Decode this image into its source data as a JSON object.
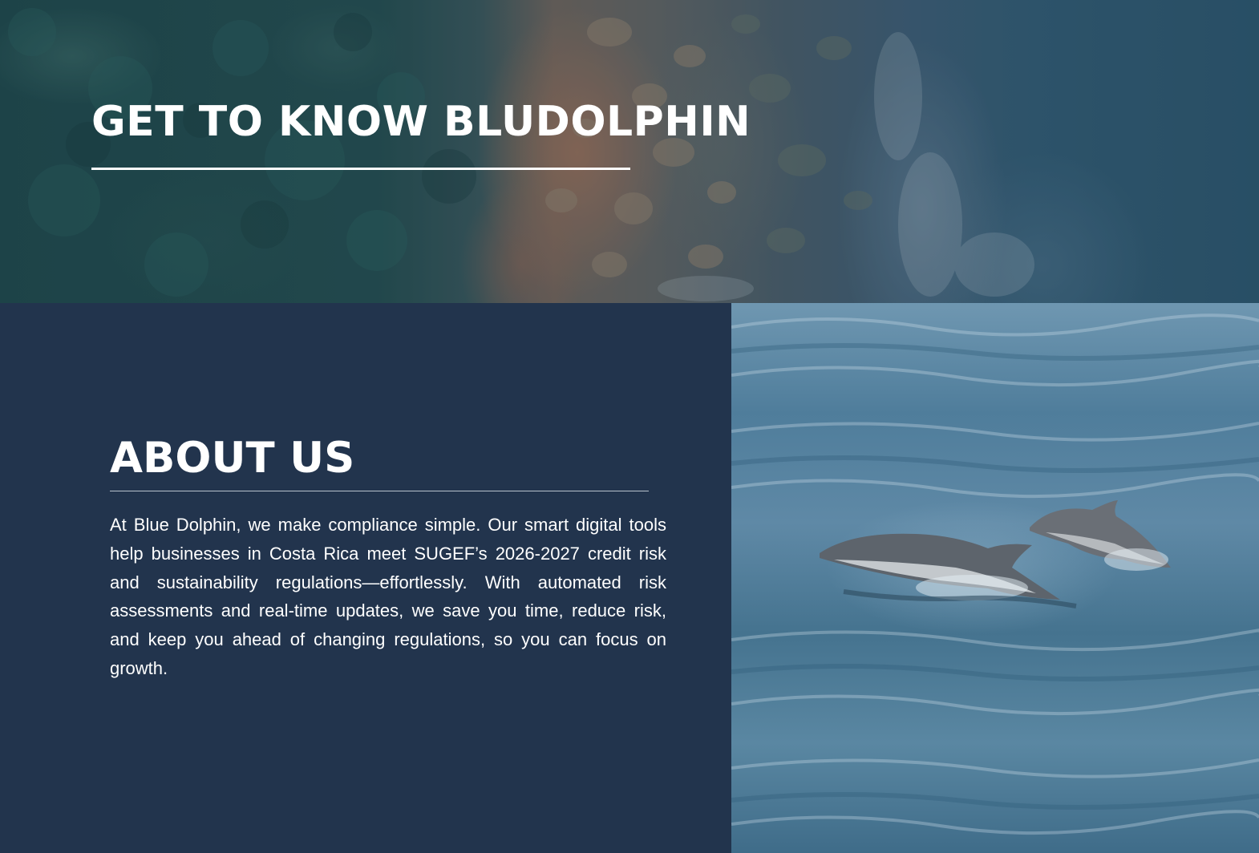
{
  "hero": {
    "title": "GET TO KNOW BLUDOLPHIN",
    "image": "aerial-coastline-photo"
  },
  "about": {
    "title": "ABOUT US",
    "body": "At Blue Dolphin, we make compliance simple. Our smart digital tools help businesses in Costa Rica meet SUGEF’s 2026-2027 credit risk and sustainability regulations—effortlessly. With automated risk assessments and real-time updates, we save you time, reduce risk, and keep you ahead of changing regulations, so you can focus on growth."
  },
  "photo": {
    "image": "two-dolphins-leaping-photo"
  },
  "colors": {
    "panel_bg": "#22344d",
    "text": "#ffffff",
    "rule": "#ffffff"
  }
}
